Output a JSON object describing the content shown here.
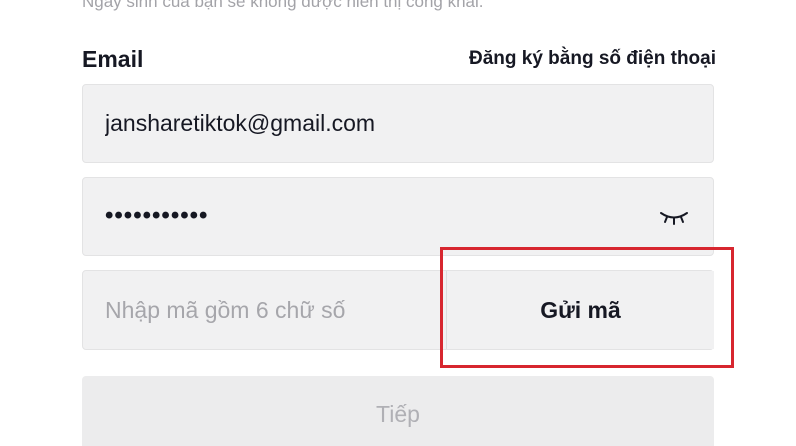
{
  "hint_text": "Ngày sinh của bạn sẽ không được hiển thị công khai.",
  "email_section": {
    "label": "Email",
    "phone_signup_link": "Đăng ký bằng số điện thoại"
  },
  "email_input": {
    "value": "jansharetiktok@gmail.com"
  },
  "password_input": {
    "masked_value": "•••••••••••",
    "toggle_icon": "eye-closed-icon"
  },
  "code_input": {
    "placeholder": "Nhập mã gồm 6 chữ số"
  },
  "send_code_button": {
    "label": "Gửi mã"
  },
  "next_button": {
    "label": "Tiếp"
  },
  "colors": {
    "highlight": "#d7262f",
    "field_bg": "#f1f1f2",
    "text": "#161823"
  }
}
